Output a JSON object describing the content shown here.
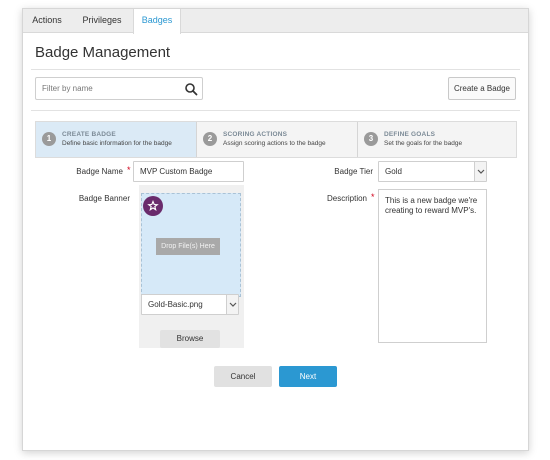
{
  "tabs": [
    {
      "label": "Actions",
      "active": false
    },
    {
      "label": "Privileges",
      "active": false
    },
    {
      "label": "Badges",
      "active": true
    }
  ],
  "page_title": "Badge Management",
  "search": {
    "placeholder": "Filter by name",
    "value": "",
    "icon": "search-icon"
  },
  "create_button": "Create a Badge",
  "wizard": {
    "steps": [
      {
        "number": "1",
        "title": "CREATE BADGE",
        "description": "Define basic information for the badge",
        "active": true
      },
      {
        "number": "2",
        "title": "SCORING ACTIONS",
        "description": "Assign scoring actions to the badge",
        "active": false
      },
      {
        "number": "3",
        "title": "DEFINE GOALS",
        "description": "Set the goals for the badge",
        "active": false
      }
    ]
  },
  "form": {
    "badge_name": {
      "label": "Badge Name",
      "required": "*",
      "value": "MVP Custom Badge"
    },
    "badge_banner": {
      "label": "Badge Banner",
      "drop_label": "Drop File(s) Here",
      "file_select": "Gold-Basic.png",
      "browse_label": "Browse"
    },
    "badge_tier": {
      "label": "Badge Tier",
      "value": "Gold"
    },
    "description": {
      "label": "Description",
      "required": "*",
      "value": "This is a new badge we're creating to reward MVP's."
    }
  },
  "footer": {
    "cancel_label": "Cancel",
    "next_label": "Next"
  },
  "colors": {
    "accent": "#2b98d2",
    "required": "#d0021b",
    "badge": "#6a2b6c",
    "step_active_bg": "#dbeaf6"
  }
}
